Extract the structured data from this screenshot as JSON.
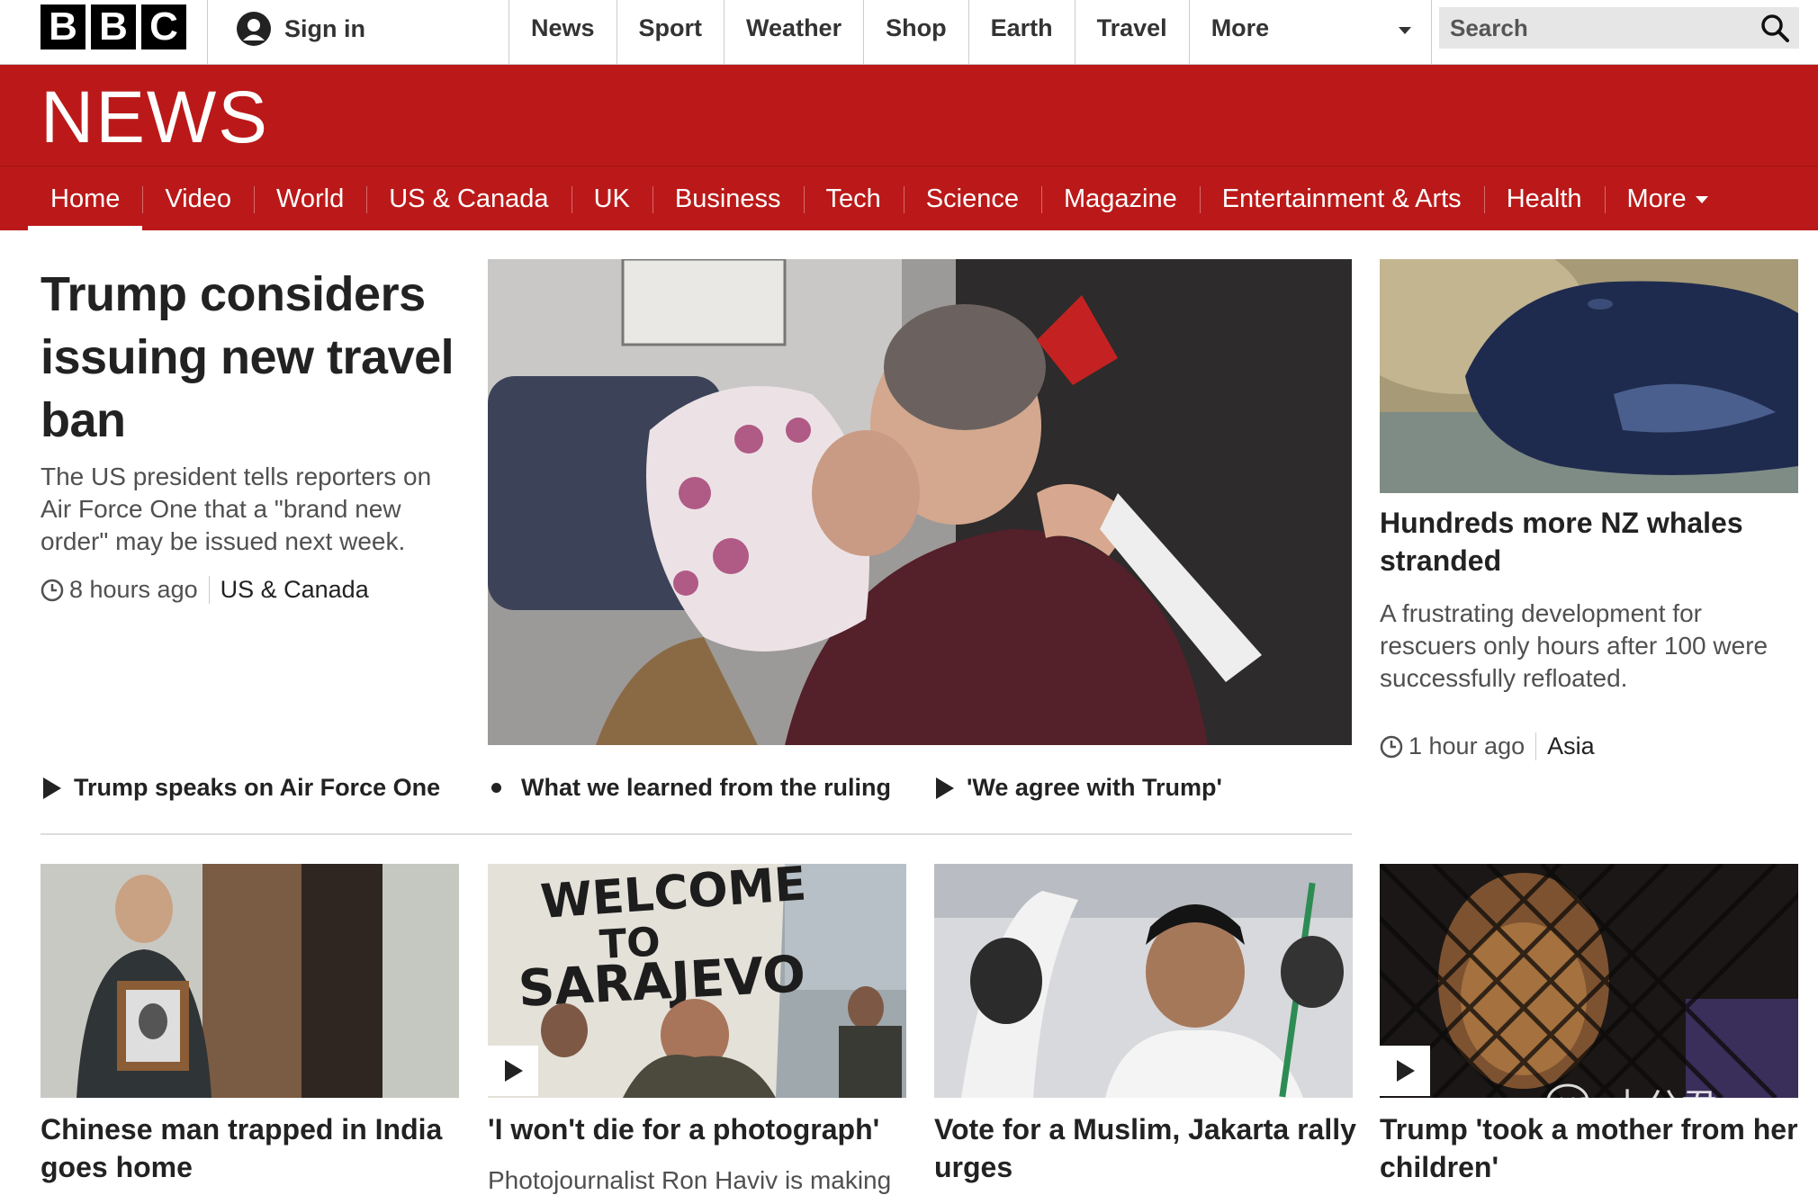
{
  "header": {
    "logo_letters": [
      "B",
      "B",
      "C"
    ],
    "sign_in": "Sign in",
    "nav": [
      "News",
      "Sport",
      "Weather",
      "Shop",
      "Earth",
      "Travel"
    ],
    "more_label": "More",
    "search_placeholder": "Search"
  },
  "masthead": {
    "title": "NEWS"
  },
  "subnav": {
    "items": [
      "Home",
      "Video",
      "World",
      "US & Canada",
      "UK",
      "Business",
      "Tech",
      "Science",
      "Magazine",
      "Entertainment & Arts",
      "Health"
    ],
    "more_label": "More",
    "active": "Home"
  },
  "lead": {
    "headline": "Trump considers issuing new travel ban",
    "summary": "The US president tells reporters on Air Force One that a \"brand new order\" may be issued next week.",
    "time": "8 hours ago",
    "section": "US & Canada"
  },
  "related": [
    {
      "label": "Trump speaks on Air Force One",
      "icon": "play-icon"
    },
    {
      "label": "What we learned from the ruling",
      "icon": "bullet-icon"
    },
    {
      "label": "'We agree with Trump'",
      "icon": "play-icon"
    }
  ],
  "side_story": {
    "headline": "Hundreds more NZ whales stranded",
    "summary": "A frustrating development for rescuers only hours after 100 were successfully refloated.",
    "time": "1 hour ago",
    "section": "Asia"
  },
  "cards": [
    {
      "headline": "Chinese man trapped in India goes home",
      "summary": "",
      "video": false
    },
    {
      "headline": "'I won't die for a photograph'",
      "summary": "Photojournalist Ron Haviv is making",
      "video": true,
      "image_text": [
        "WELCOME",
        "TO",
        "SARAJEVO"
      ]
    },
    {
      "headline": "Vote for a Muslim, Jakarta rally urges",
      "summary": "",
      "video": false
    },
    {
      "headline": "Trump 'took a mother from her children'",
      "summary": "",
      "video": true
    }
  ],
  "watermark": {
    "text": "十分君"
  },
  "colors": {
    "brand_red": "#bb1919",
    "text": "#222222",
    "summary_text": "#505050"
  }
}
